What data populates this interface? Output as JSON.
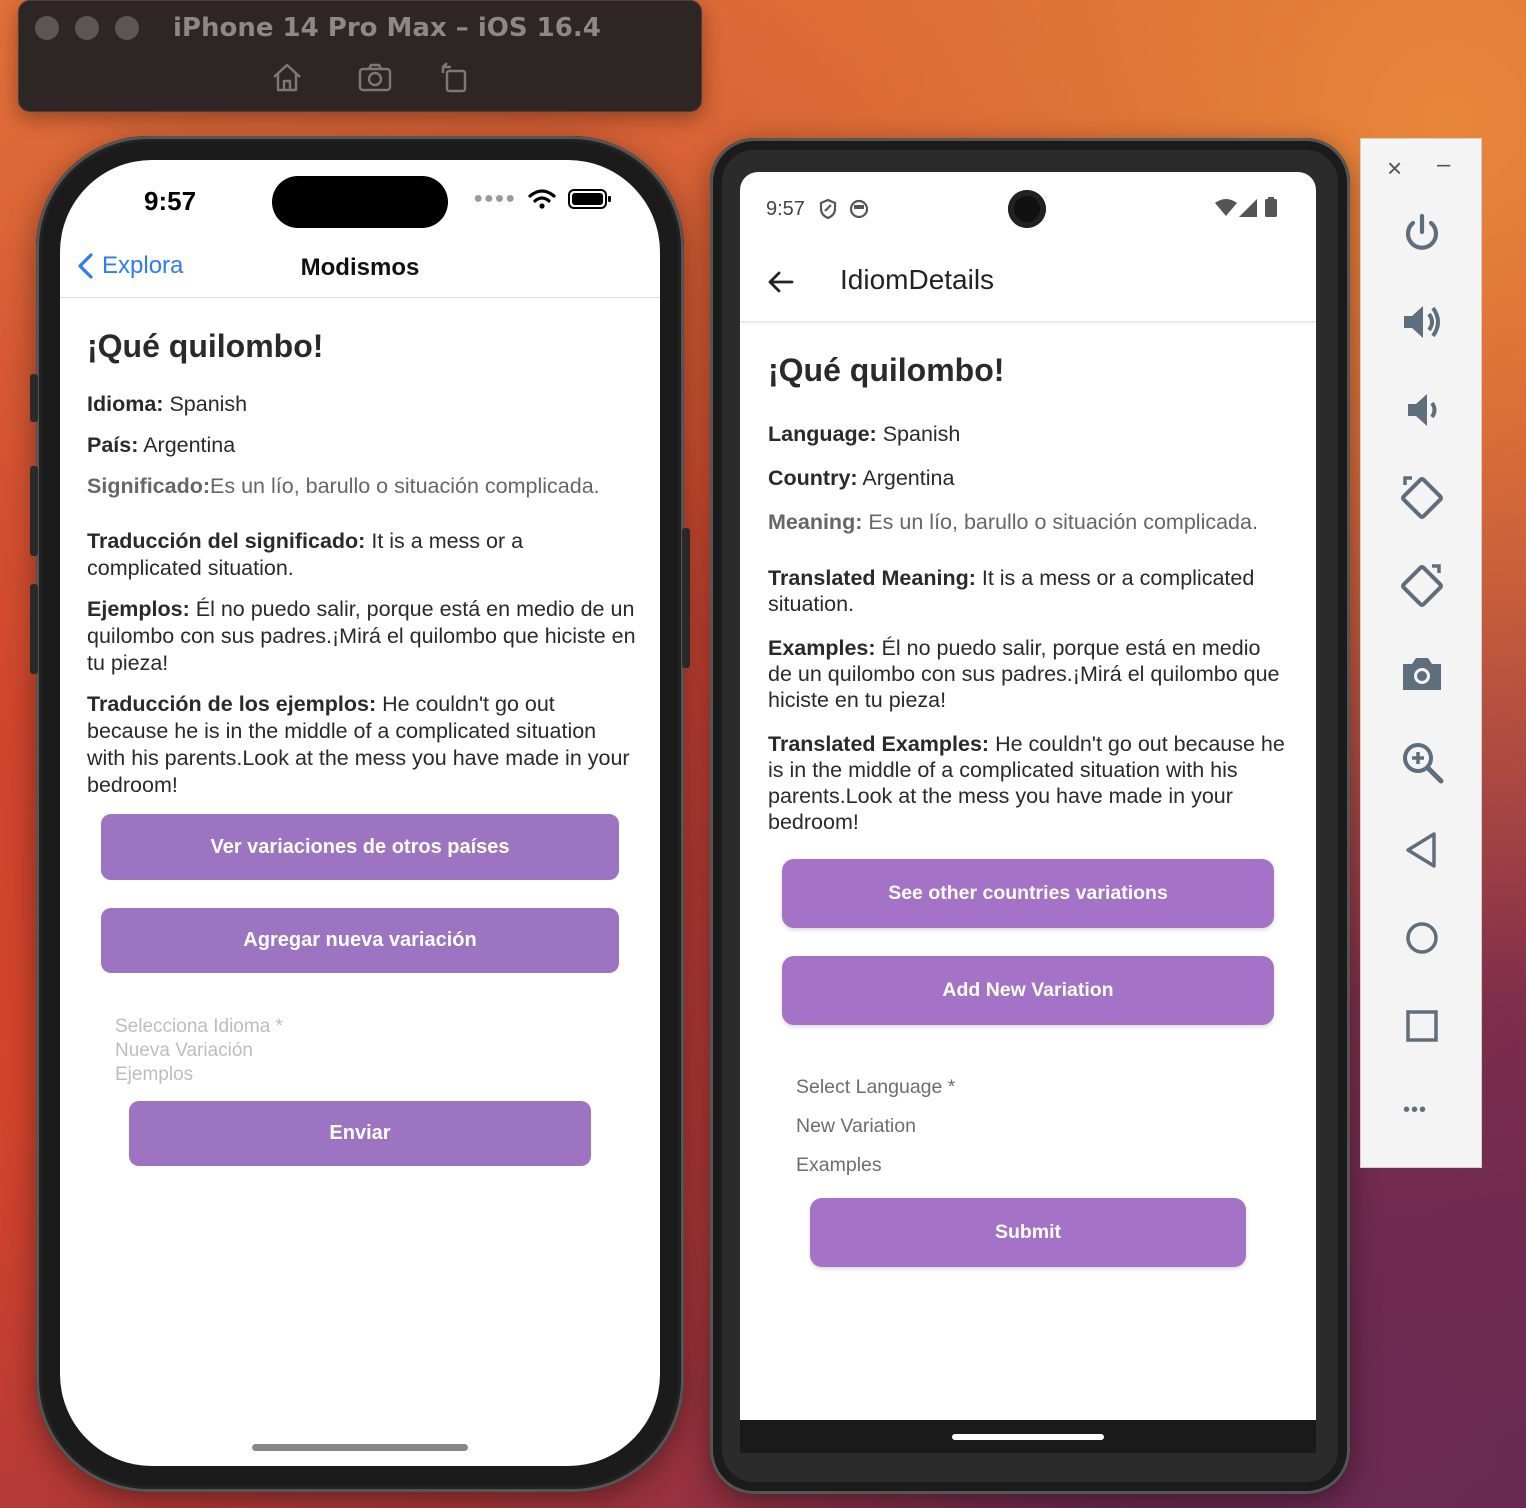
{
  "simulator": {
    "title": "iPhone 14 Pro Max – iOS 16.4",
    "toolbar_icons": [
      "home-icon",
      "screenshot-icon",
      "rotate-icon"
    ]
  },
  "ios": {
    "time": "9:57",
    "nav": {
      "back_label": "Explora",
      "title": "Modismos"
    },
    "idiom_title": "¡Qué quilombo!",
    "language_label": "Idioma:",
    "language_value": "Spanish",
    "country_label": "País:",
    "country_value": "Argentina",
    "meaning_label": "Significado:",
    "meaning_value": "Es un lío, barullo o situación complicada.",
    "translated_meaning_label": "Traducción del significado:",
    "translated_meaning_value": "It is a mess or a complicated situation.",
    "examples_label": "Ejemplos:",
    "examples_value": "Él no puedo salir, porque está en medio de un quilombo con sus padres.¡Mirá el quilombo que hiciste en tu pieza!",
    "translated_examples_label": "Traducción de los ejemplos:",
    "translated_examples_value": "He couldn't go out because he is in the middle of a complicated situation with his parents.Look at the mess you have made in your bedroom!",
    "see_variations_button": "Ver variaciones de otros países",
    "add_variation_button": "Agregar nueva variación",
    "select_language_placeholder": "Selecciona Idioma *",
    "new_variation_placeholder": "Nueva Variación",
    "examples_placeholder": "Ejemplos",
    "submit_button": "Enviar"
  },
  "android": {
    "time": "9:57",
    "appbar_title": "IdiomDetails",
    "idiom_title": "¡Qué quilombo!",
    "language_label": "Language:",
    "language_value": "Spanish",
    "country_label": "Country:",
    "country_value": "Argentina",
    "meaning_label": "Meaning:",
    "meaning_value": "Es un lío, barullo o situación complicada.",
    "translated_meaning_label": "Translated Meaning:",
    "translated_meaning_value": "It is a mess or a complicated situation.",
    "examples_label": "Examples:",
    "examples_value": "Él no puedo salir, porque está en medio de un quilombo con sus padres.¡Mirá el quilombo que hiciste en tu pieza!",
    "translated_examples_label": "Translated Examples:",
    "translated_examples_value": "He couldn't go out because he is in the middle of a complicated situation with his parents.Look at the mess you have made in your bedroom!",
    "see_variations_button": "See other countries variations",
    "add_variation_button": "Add New Variation",
    "select_language_placeholder": "Select Language *",
    "new_variation_placeholder": "New Variation",
    "examples_placeholder": "Examples",
    "submit_button": "Submit"
  },
  "emulator_toolbar": {
    "close_glyph": "×",
    "minimize_glyph": "–",
    "more_glyph": "•••",
    "icons": [
      "power-icon",
      "volume-up-icon",
      "volume-down-icon",
      "rotate-left-icon",
      "rotate-right-icon",
      "camera-icon",
      "zoom-icon",
      "back-icon",
      "home-icon",
      "overview-icon",
      "more-icon"
    ]
  },
  "colors": {
    "button_purple_ios": "#9c74c2",
    "button_purple_android": "#a472c6",
    "ios_link_blue": "#2b7cf6"
  }
}
